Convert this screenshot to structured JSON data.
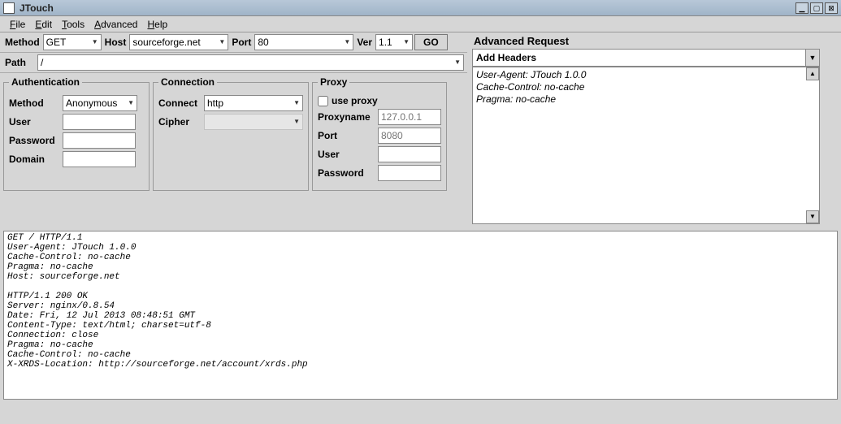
{
  "title": "JTouch",
  "menu": [
    "File",
    "Edit",
    "Tools",
    "Advanced",
    "Help"
  ],
  "toolbar": {
    "method_label": "Method",
    "method_value": "GET",
    "host_label": "Host",
    "host_value": "sourceforge.net",
    "port_label": "Port",
    "port_value": "80",
    "ver_label": "Ver",
    "ver_value": "1.1",
    "go_label": "GO",
    "path_label": "Path",
    "path_value": "/"
  },
  "auth": {
    "legend": "Authentication",
    "method_label": "Method",
    "method_value": "Anonymous",
    "user_label": "User",
    "user_value": "",
    "password_label": "Password",
    "password_value": "",
    "domain_label": "Domain",
    "domain_value": ""
  },
  "conn": {
    "legend": "Connection",
    "connect_label": "Connect",
    "connect_value": "http",
    "cipher_label": "Cipher",
    "cipher_value": ""
  },
  "proxy": {
    "legend": "Proxy",
    "use_label": "use proxy",
    "use_checked": false,
    "name_label": "Proxyname",
    "name_placeholder": "127.0.0.1",
    "port_label": "Port",
    "port_placeholder": "8080",
    "user_label": "User",
    "user_value": "",
    "password_label": "Password",
    "password_value": ""
  },
  "advanced": {
    "title": "Advanced Request",
    "add_headers_label": "Add Headers",
    "headers_text": "User-Agent: JTouch 1.0.0\nCache-Control: no-cache\nPragma: no-cache"
  },
  "output": "GET / HTTP/1.1\nUser-Agent: JTouch 1.0.0\nCache-Control: no-cache\nPragma: no-cache\nHost: sourceforge.net\n\nHTTP/1.1 200 OK\nServer: nginx/0.8.54\nDate: Fri, 12 Jul 2013 08:48:51 GMT\nContent-Type: text/html; charset=utf-8\nConnection: close\nPragma: no-cache\nCache-Control: no-cache\nX-XRDS-Location: http://sourceforge.net/account/xrds.php"
}
